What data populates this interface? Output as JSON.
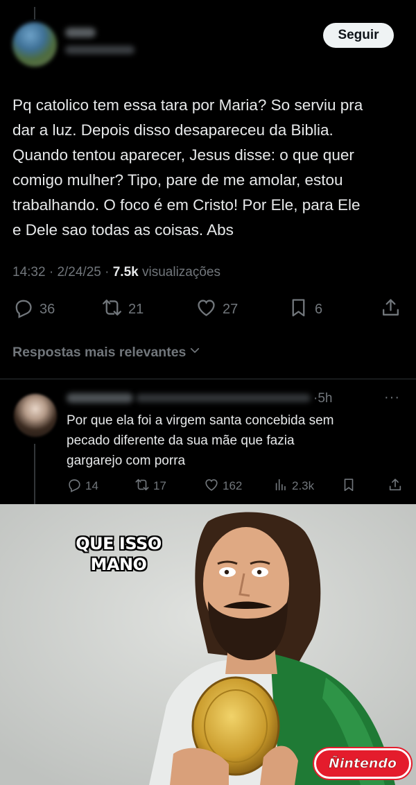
{
  "post": {
    "follow_label": "Seguir",
    "text_lines": [
      "Pq catolico tem essa tara por Maria? So serviu pra",
      "dar a luz. Depois disso desapareceu da Biblia.",
      "Quando tentou aparecer, Jesus disse: o que quer",
      "comigo mulher? Tipo, pare de me amolar, estou",
      "trabalhando. O foco é em Cristo! Por Ele, para Ele",
      "e Dele sao todas as coisas. Abs"
    ],
    "time": "14:32",
    "date": "2/24/25",
    "views_count": "7.5k",
    "views_label": "visualizações",
    "replies": "36",
    "reposts": "21",
    "likes": "27",
    "bookmarks": "6"
  },
  "replies_header": "Respostas mais relevantes",
  "reply": {
    "time": "·5h",
    "more": "···",
    "text_lines": [
      "Por que ela foi a virgem santa concebida sem",
      "pecado diferente da sua mãe que fazia",
      "gargarejo com porra"
    ],
    "replies": "14",
    "reposts": "17",
    "likes": "162",
    "views": "2.3k"
  },
  "meme": {
    "caption_lines": [
      "QUE ISSO",
      "MANO"
    ],
    "logo_text": "Ñintendo"
  },
  "colors": {
    "background": "#000000",
    "text": "#e7e9ea",
    "muted": "#71767b",
    "follow_bg": "#eff3f4",
    "logo_red": "#e41c2c"
  }
}
